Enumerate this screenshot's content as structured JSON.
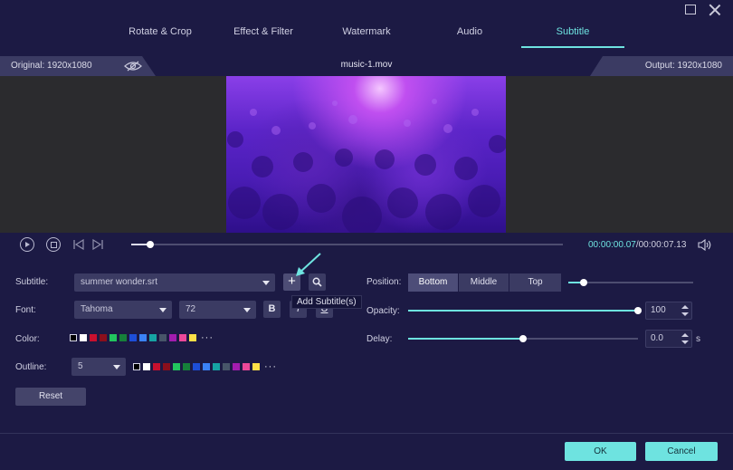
{
  "tabs": [
    {
      "label": "Rotate & Crop",
      "active": false
    },
    {
      "label": "Effect & Filter",
      "active": false
    },
    {
      "label": "Watermark",
      "active": false
    },
    {
      "label": "Audio",
      "active": false
    },
    {
      "label": "Subtitle",
      "active": true
    }
  ],
  "infobar": {
    "original": "Original: 1920x1080",
    "file_name": "music-1.mov",
    "output": "Output: 1920x1080"
  },
  "playback": {
    "time_current": "00:00:00.07",
    "time_total": "/00:00:07.13",
    "progress_fraction": 0.045
  },
  "subtitle": {
    "label": "Subtitle:",
    "file": "summer wonder.srt",
    "add_tooltip": "Add Subtitle(s)",
    "add_symbol": "+",
    "search_symbol": "⚲"
  },
  "font": {
    "label": "Font:",
    "family": "Tahoma",
    "size": "72",
    "bold": "B",
    "italic": "I",
    "underline": "U"
  },
  "color": {
    "label": "Color:",
    "swatches": [
      "#000000",
      "#ffffff",
      "#c8102e",
      "#8b0f1c",
      "#22c55e",
      "#16803a",
      "#1d4ed8",
      "#3b82f6",
      "#16a3a3",
      "#475569",
      "#a21caf",
      "#ec4899",
      "#fde047"
    ],
    "more": "···"
  },
  "outline": {
    "label": "Outline:",
    "width": "5",
    "swatches": [
      "#000000",
      "#ffffff",
      "#c8102e",
      "#8b0f1c",
      "#22c55e",
      "#16803a",
      "#1d4ed8",
      "#3b82f6",
      "#16a3a3",
      "#475569",
      "#a21caf",
      "#ec4899",
      "#fde047"
    ],
    "more": "···"
  },
  "reset_label": "Reset",
  "position": {
    "label": "Position:",
    "options": [
      "Bottom",
      "Middle",
      "Top"
    ],
    "selected": "Bottom",
    "slider_fraction": 0.12
  },
  "opacity": {
    "label": "Opacity:",
    "value": "100",
    "fraction": 1.0
  },
  "delay": {
    "label": "Delay:",
    "value": "0.0",
    "unit": "s",
    "fraction": 0.5
  },
  "footer": {
    "ok": "OK",
    "cancel": "Cancel"
  },
  "colors": {
    "accent": "#6ee3e0",
    "background": "#1c1a44",
    "panel": "#3b3b63"
  }
}
